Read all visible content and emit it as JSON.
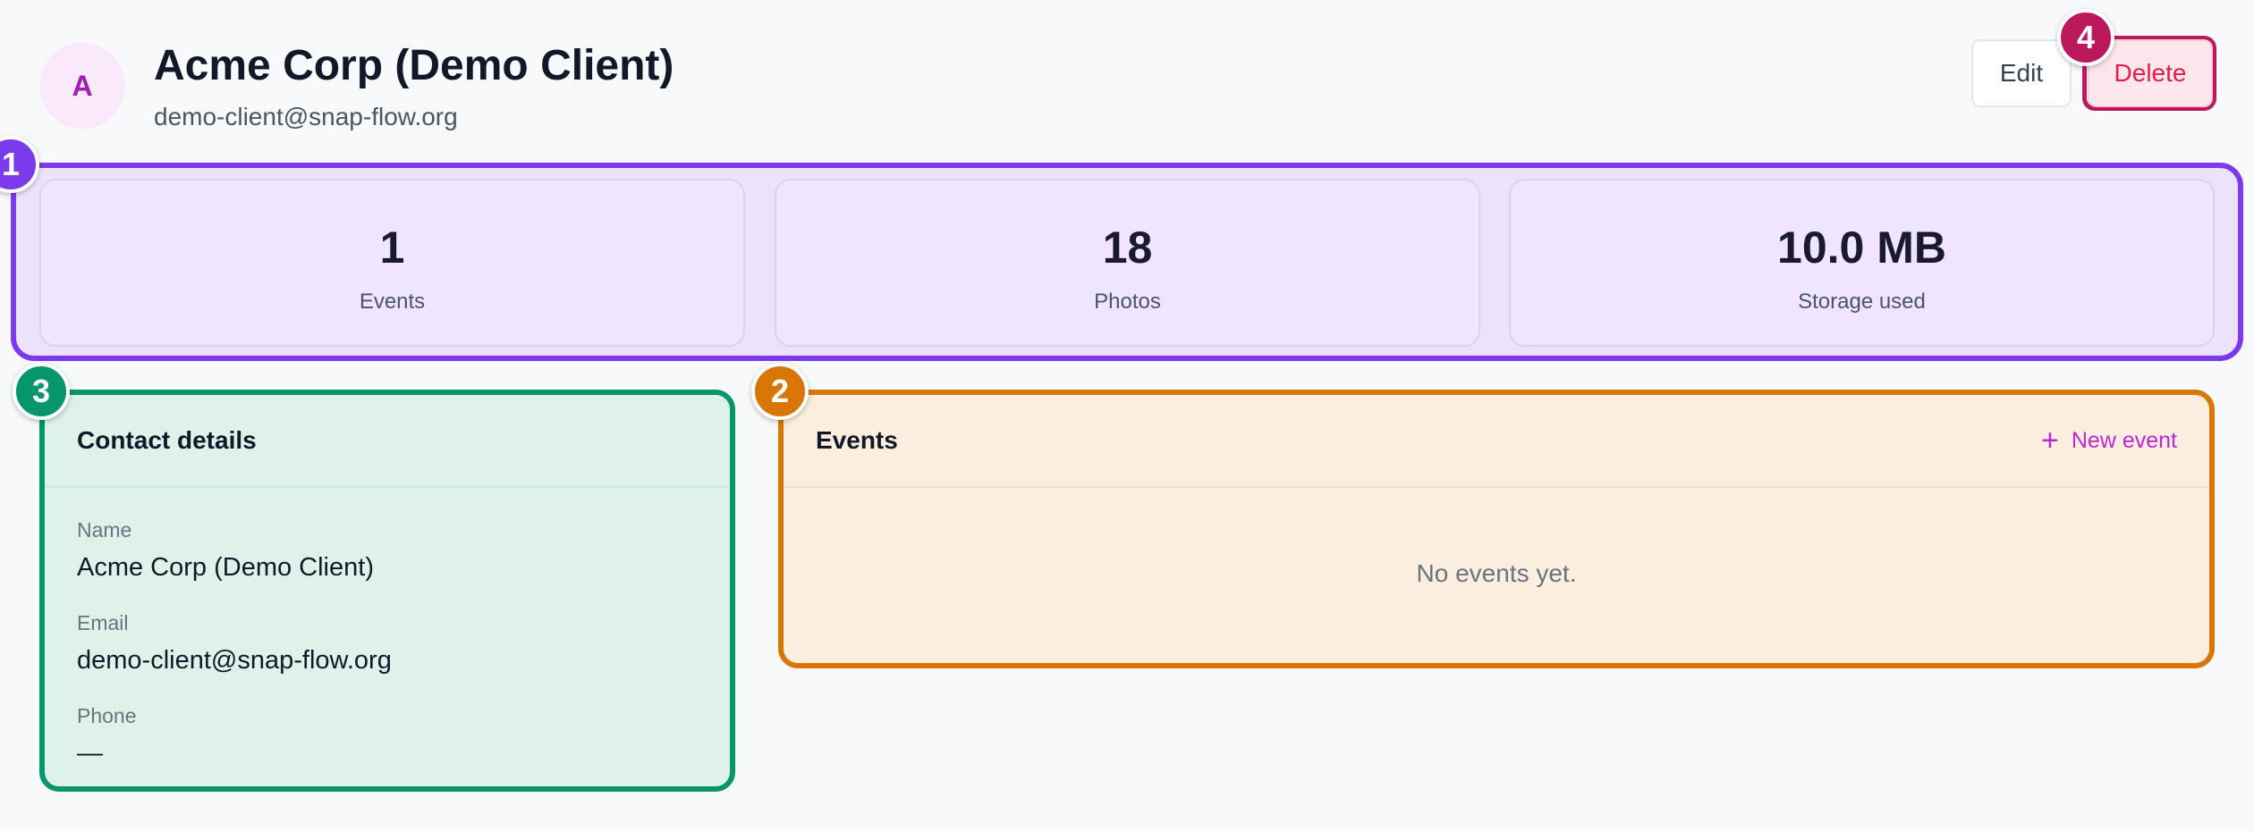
{
  "client": {
    "avatar_letter": "A",
    "name": "Acme Corp (Demo Client)",
    "email": "demo-client@snap-flow.org"
  },
  "actions": {
    "edit_label": "Edit",
    "delete_label": "Delete"
  },
  "stats": [
    {
      "value": "1",
      "label": "Events"
    },
    {
      "value": "18",
      "label": "Photos"
    },
    {
      "value": "10.0 MB",
      "label": "Storage used"
    }
  ],
  "contact": {
    "title": "Contact details",
    "fields": [
      {
        "label": "Name",
        "value": "Acme Corp (Demo Client)"
      },
      {
        "label": "Email",
        "value": "demo-client@snap-flow.org"
      },
      {
        "label": "Phone",
        "value": "—"
      }
    ]
  },
  "events": {
    "title": "Events",
    "new_event_label": "New event",
    "empty_text": "No events yet."
  },
  "markers": [
    "1",
    "2",
    "3",
    "4"
  ],
  "colors": {
    "marker_1": "#7c3aed",
    "marker_2": "#d97706",
    "marker_3": "#059669",
    "marker_4": "#be185d",
    "accent": "#c026d3",
    "danger": "#e11d48"
  },
  "icons": {
    "new_event": "plus-icon"
  }
}
